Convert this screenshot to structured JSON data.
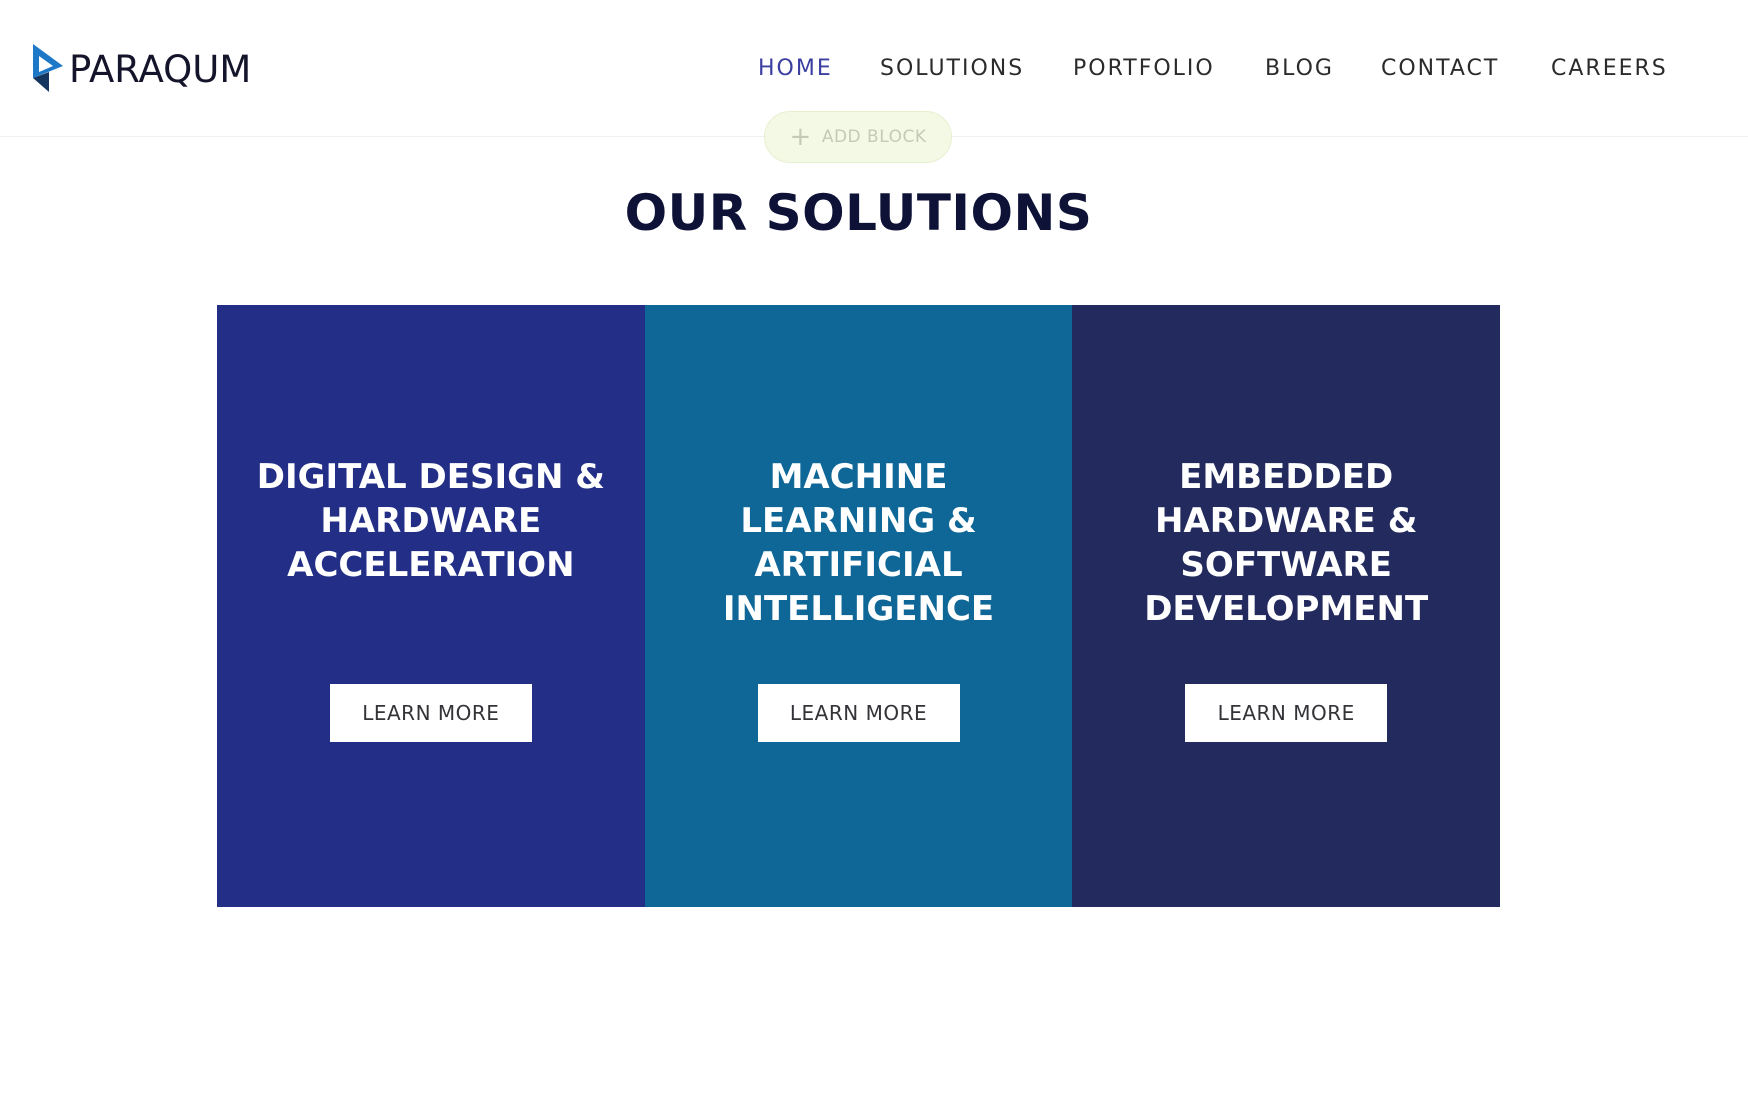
{
  "brand": {
    "name": "PARAQUM"
  },
  "nav": {
    "items": [
      {
        "label": "HOME",
        "active": true
      },
      {
        "label": "SOLUTIONS",
        "active": false
      },
      {
        "label": "PORTFOLIO",
        "active": false
      },
      {
        "label": "BLOG",
        "active": false
      },
      {
        "label": "CONTACT",
        "active": false
      },
      {
        "label": "CAREERS",
        "active": false
      }
    ]
  },
  "editor": {
    "add_block_label": "ADD BLOCK",
    "add_block_icon": "plus-icon"
  },
  "section": {
    "title": "OUR SOLUTIONS",
    "cards": [
      {
        "title": "DIGITAL DESIGN & HARDWARE ACCELERATION",
        "button": "LEARN MORE",
        "color": "#232f86"
      },
      {
        "title": "MACHINE LEARNING & ARTIFICIAL INTELLIGENCE",
        "button": "LEARN MORE",
        "color": "#0f6797"
      },
      {
        "title": "EMBEDDED HARDWARE & SOFTWARE DEVELOPMENT",
        "button": "LEARN MORE",
        "color": "#232a5e"
      }
    ]
  },
  "colors": {
    "nav_active": "#3b3fa0",
    "nav_text": "#2b2b2b",
    "title": "#0d1236",
    "logo_blue": "#1e78c8"
  }
}
